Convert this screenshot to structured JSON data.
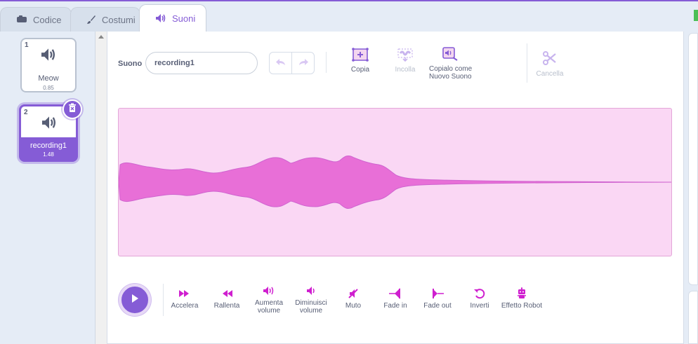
{
  "tabs": [
    {
      "label": "Codice",
      "icon": "code-icon"
    },
    {
      "label": "Costumi",
      "icon": "brush-icon"
    },
    {
      "label": "Suoni",
      "icon": "speaker-icon"
    }
  ],
  "sounds": [
    {
      "number": "1",
      "name": "Meow",
      "duration": "0.85"
    },
    {
      "number": "2",
      "name": "recording1",
      "duration": "1.48"
    }
  ],
  "editor": {
    "sound_label": "Suono",
    "sound_name": "recording1",
    "copy_label": "Copia",
    "paste_label": "Incolla",
    "copy_new_label_1": "Copialo come",
    "copy_new_label_2": "Nuovo Suono",
    "delete_label": "Cancella"
  },
  "effects": {
    "faster": "Accelera",
    "slower": "Rallenta",
    "louder_1": "Aumenta",
    "louder_2": "volume",
    "softer_1": "Diminuisci",
    "softer_2": "volume",
    "mute": "Muto",
    "fade_in": "Fade in",
    "fade_out": "Fade out",
    "reverse": "Inverti",
    "robot": "Effetto Robot"
  },
  "colors": {
    "accent": "#855cd6",
    "sound_effect": "#cf63cf",
    "waveform_bg": "#fad7f4",
    "waveform_fill": "#e86fd7"
  }
}
